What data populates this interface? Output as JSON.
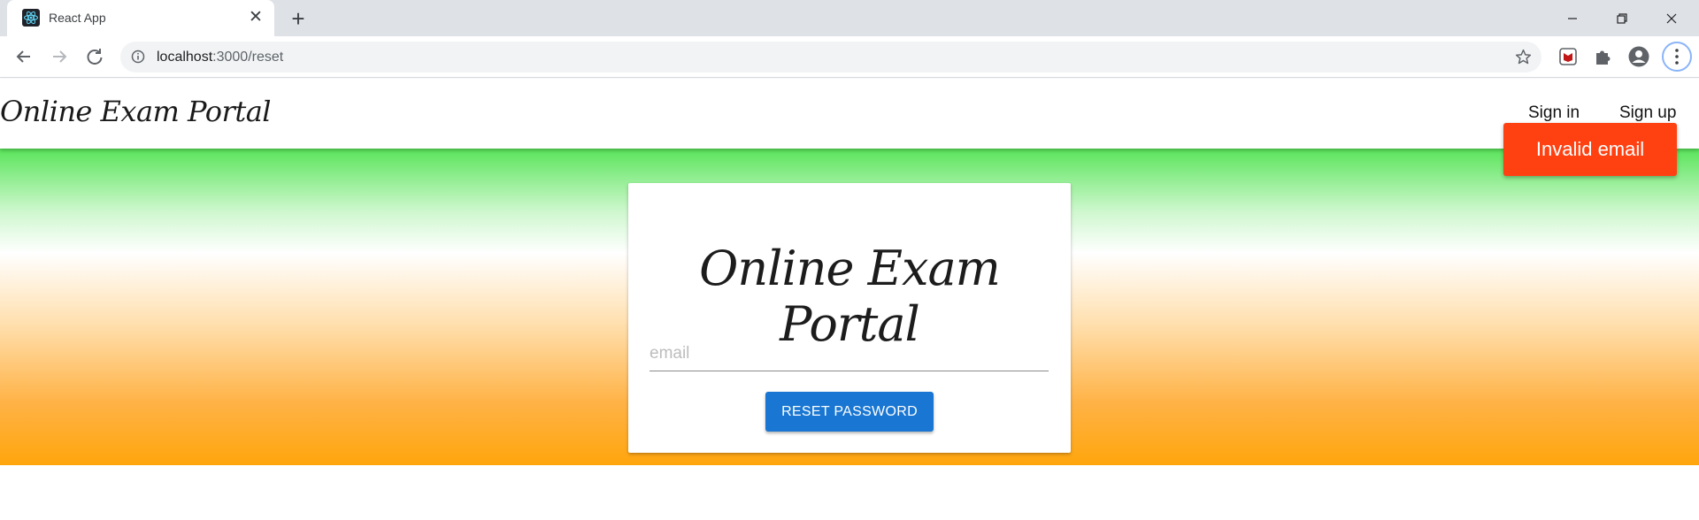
{
  "browser": {
    "tab_title": "React App",
    "tab_favicon": "react-icon",
    "url_host": "localhost",
    "url_path": ":3000/reset"
  },
  "app_bar": {
    "brand": "Online Exam Portal",
    "nav": [
      {
        "label": "Sign in"
      },
      {
        "label": "Sign up"
      }
    ]
  },
  "reset_form": {
    "title": "Online Exam Portal",
    "email_placeholder": "email",
    "email_value": "",
    "submit_label": "RESET PASSWORD"
  },
  "toast": {
    "message": "Invalid email",
    "color": "#ff4112"
  },
  "colors": {
    "primary_button": "#1976d2",
    "hero_top": "#5ae55a",
    "hero_bottom": "#ffa50c"
  }
}
